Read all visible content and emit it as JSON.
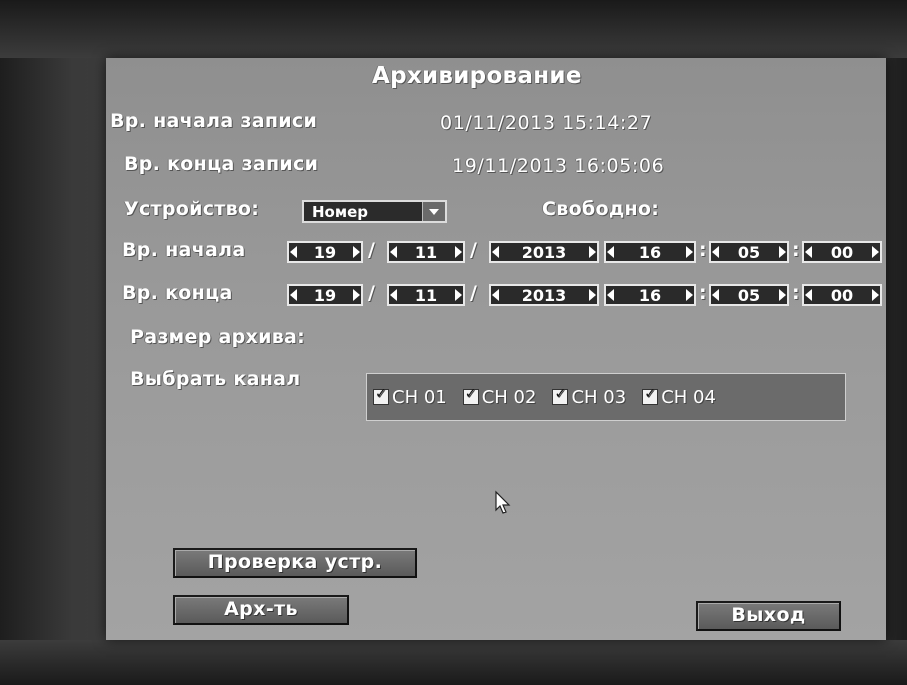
{
  "dialog": {
    "title": "Архивирование",
    "rec_start_label": "Вр. начала записи",
    "rec_start_value": "01/11/2013 15:14:27",
    "rec_end_label": "Вр. конца записи",
    "rec_end_value": "19/11/2013 16:05:06",
    "device_label": "Устройство:",
    "device_value": "Номер",
    "free_label": "Свободно:",
    "start_label": "Вр. начала",
    "end_label": "Вр. конца",
    "start": {
      "day": "19",
      "month": "11",
      "year": "2013",
      "hour": "16",
      "minute": "05",
      "second": "00"
    },
    "end": {
      "day": "19",
      "month": "11",
      "year": "2013",
      "hour": "16",
      "minute": "05",
      "second": "00"
    },
    "date_sep": "/",
    "time_sep": ":",
    "size_label": "Размер архива:",
    "channel_label": "Выбрать канал",
    "channels": [
      {
        "label": "CH 01",
        "checked": true
      },
      {
        "label": "CH 02",
        "checked": true
      },
      {
        "label": "CH 03",
        "checked": true
      },
      {
        "label": "CH 04",
        "checked": true
      }
    ],
    "buttons": {
      "check_device": "Проверка устр.",
      "archive": "Арх-ть",
      "exit": "Выход"
    }
  }
}
